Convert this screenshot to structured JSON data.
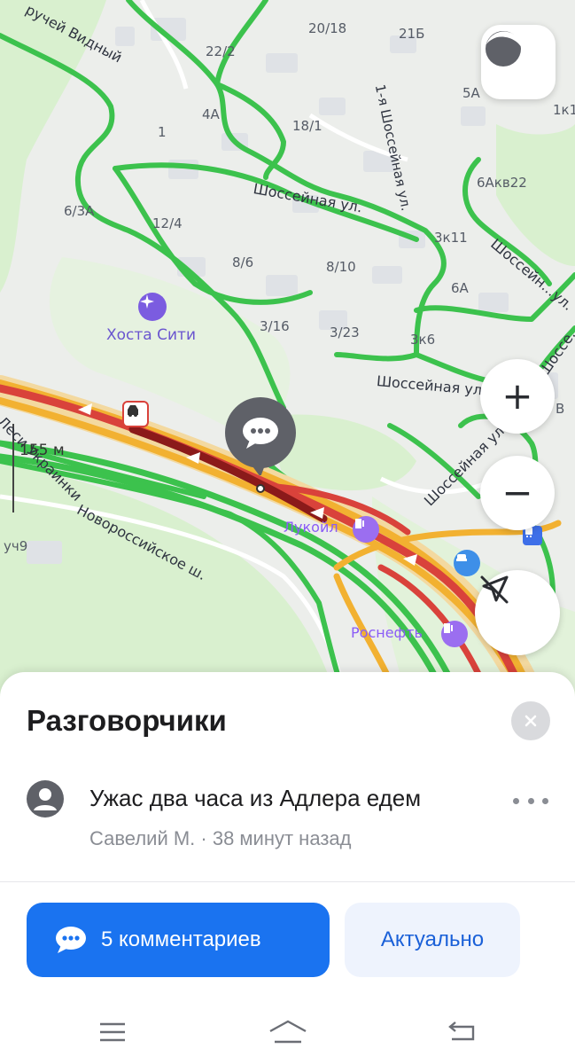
{
  "map": {
    "house_numbers": [
      "20/18",
      "21Б",
      "22/2",
      "5А",
      "1к1",
      "4А",
      "18/1",
      "1",
      "6Акв22",
      "6/3А",
      "12/4",
      "3к11",
      "8/6",
      "8/10",
      "6А",
      "3/16",
      "3/23",
      "3к6",
      "В",
      "уч9"
    ],
    "streets": {
      "ruchey": "ручей Видный",
      "shosseynaya_top": "Шоссейная ул.",
      "shosseynaya_mid": "Шоссейная ул.",
      "shosseynaya_vert": "1-я Шоссейная ул.",
      "shosseynaya_right": "Шоссейн...ул.",
      "shosseynaya_right2": "Шоссе...",
      "shosseynaya_low": "Шоссейная ул.",
      "ukrainki": "Леси Украинки",
      "novoross": "Новороссийское ш."
    },
    "pois": {
      "khosta": "Хоста Сити",
      "lukoil": "Лукойл",
      "rosneft": "Роснефть"
    },
    "scale": "155 м",
    "icons": [
      "location-arrow-icon",
      "zoom-in-icon",
      "zoom-out-icon",
      "no-navigation-icon",
      "chat-bubble-icon",
      "traffic-accident-icon",
      "fuel-icon",
      "armchair-icon",
      "bus-stop-icon"
    ],
    "colors": {
      "jam": "#d9423b",
      "heavy": "#8b1a1a",
      "slow": "#f2b131",
      "free": "#3cc24d"
    }
  },
  "buttons": {
    "zoom_in": "+",
    "zoom_out": "−"
  },
  "sheet": {
    "title": "Разговорчики",
    "message": "Ужас два часа из Адлера едем",
    "author": "Савелий М.",
    "separator": " · ",
    "time_ago": "38 минут назад",
    "comments_label": "5 комментариев",
    "relevant_label": "Актуально",
    "accent": "#1a73f0"
  },
  "navbar": {
    "icons": [
      "menu-icon",
      "home-icon",
      "back-icon"
    ]
  }
}
